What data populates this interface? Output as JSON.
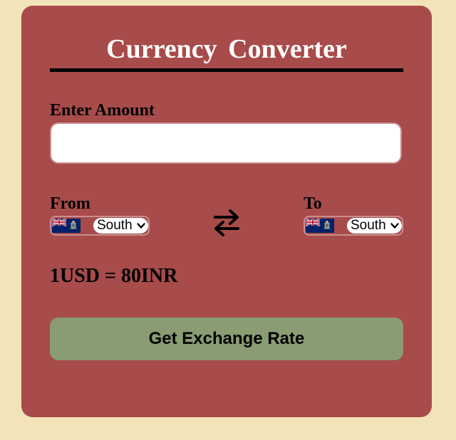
{
  "header": {
    "title": "Currency Converter"
  },
  "amount": {
    "label": "Enter Amount",
    "value": "",
    "placeholder": ""
  },
  "from": {
    "label": "From",
    "selected": "South Georgia and the South Sandwich Islands",
    "display": "South",
    "flag_icon": "south-georgia-flag-icon"
  },
  "to": {
    "label": "To",
    "selected": "South Georgia and the South Sandwich Islands",
    "display": "South",
    "flag_icon": "south-georgia-flag-icon"
  },
  "swap": {
    "icon": "swap-arrows-icon"
  },
  "result": {
    "text": "1USD = 80INR"
  },
  "actions": {
    "get_rate_label": "Get Exchange Rate"
  },
  "colors": {
    "page_background": "#f3e3b9",
    "card_background": "#a84b4b",
    "button_background": "#8a9c72",
    "title_text": "#ffffff"
  }
}
